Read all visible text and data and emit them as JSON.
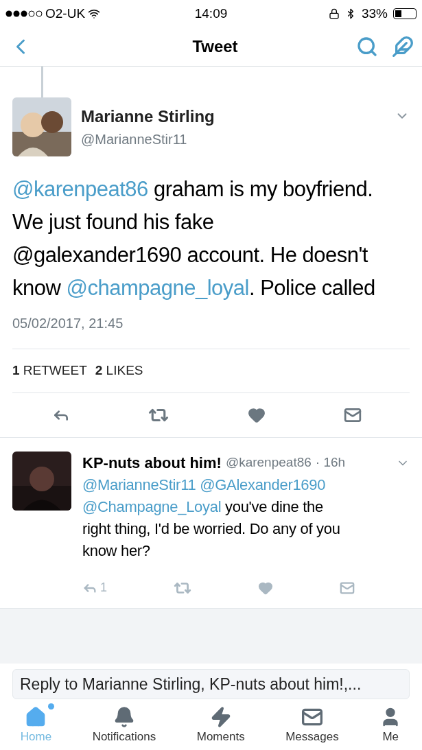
{
  "status_bar": {
    "carrier": "O2-UK",
    "time": "14:09",
    "battery": "33%"
  },
  "nav": {
    "title": "Tweet"
  },
  "tweet": {
    "name": "Marianne Stirling",
    "handle": "@MarianneStir11",
    "lines": [
      [
        {
          "kind": "mention",
          "text": "@karenpeat86"
        },
        {
          "kind": "text",
          "text": " graham is my boyfriend."
        }
      ],
      [
        {
          "kind": "text",
          "text": "We just found his fake"
        }
      ],
      [
        {
          "kind": "text",
          "text": "@galexander1690 account. He doesn't"
        }
      ],
      [
        {
          "kind": "text",
          "text": "know "
        },
        {
          "kind": "mention",
          "text": "@champagne_loyal"
        },
        {
          "kind": "text",
          "text": ". Police called"
        }
      ]
    ],
    "timestamp": "05/02/2017, 21:45",
    "stats": [
      {
        "count": "1",
        "label": "RETWEET"
      },
      {
        "count": "2",
        "label": "LIKES"
      }
    ]
  },
  "reply": {
    "name": "KP-nuts about him!",
    "handle": "@karenpeat86",
    "time": "· 16h",
    "lines": [
      [
        {
          "kind": "mention",
          "text": "@MarianneStir11 @GAlexander1690"
        }
      ],
      [
        {
          "kind": "mention",
          "text": "@Champagne_Loyal"
        },
        {
          "kind": "text",
          "text": " you've dine the"
        }
      ],
      [
        {
          "kind": "text",
          "text": "right thing, I'd be worried. Do any of you"
        }
      ],
      [
        {
          "kind": "text",
          "text": "know her?"
        }
      ]
    ],
    "reply_count": "1"
  },
  "reply_field": {
    "placeholder": "Reply to Marianne Stirling, KP-nuts about him!,..."
  },
  "tabs": [
    {
      "label": "Home",
      "selected": true,
      "badge": true,
      "kind": "home"
    },
    {
      "label": "Notifications",
      "selected": false,
      "badge": false,
      "kind": "bell"
    },
    {
      "label": "Moments",
      "selected": false,
      "badge": false,
      "kind": "bolt"
    },
    {
      "label": "Messages",
      "selected": false,
      "badge": false,
      "kind": "mail"
    },
    {
      "label": "Me",
      "selected": false,
      "badge": false,
      "kind": "person"
    }
  ]
}
